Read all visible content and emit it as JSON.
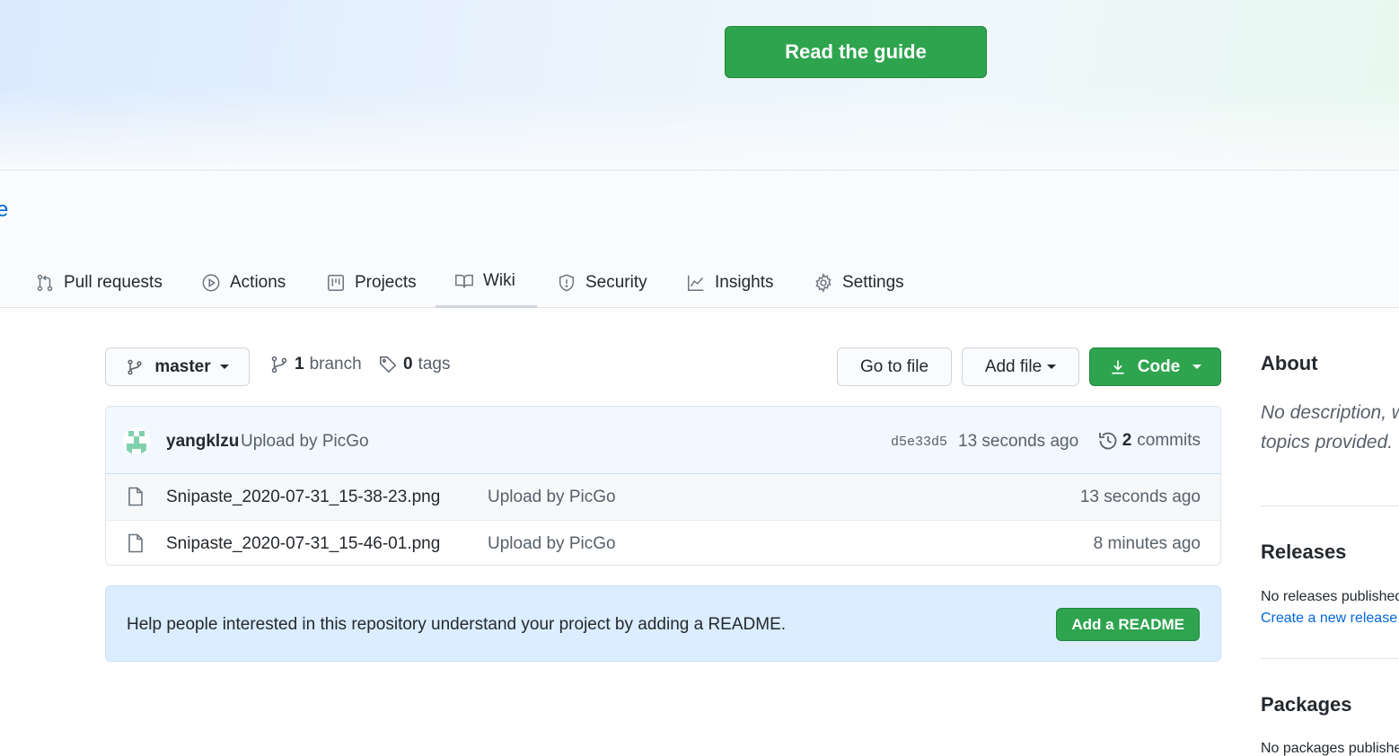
{
  "hero": {
    "guide_button": "Read the guide"
  },
  "repo": {
    "name_fragment": "e"
  },
  "tabs": [
    {
      "label": "Pull requests",
      "icon": "git-pull-request-icon"
    },
    {
      "label": "Actions",
      "icon": "play-icon"
    },
    {
      "label": "Projects",
      "icon": "project-icon"
    },
    {
      "label": "Wiki",
      "icon": "book-icon",
      "active": true
    },
    {
      "label": "Security",
      "icon": "shield-icon"
    },
    {
      "label": "Insights",
      "icon": "graph-icon"
    },
    {
      "label": "Settings",
      "icon": "gear-icon"
    }
  ],
  "toolbar": {
    "branch_select": "master",
    "branch_count": "1",
    "branch_label": "branch",
    "tag_count": "0",
    "tag_label": "tags",
    "go_to_file": "Go to file",
    "add_file": "Add file",
    "code": "Code"
  },
  "latest_commit": {
    "author": "yangklzu",
    "message": "Upload by PicGo",
    "sha": "d5e33d5",
    "time": "13 seconds ago",
    "commit_count": "2",
    "commit_label": "commits"
  },
  "files": [
    {
      "name": "Snipaste_2020-07-31_15-38-23.png",
      "message": "Upload by PicGo",
      "time": "13 seconds ago"
    },
    {
      "name": "Snipaste_2020-07-31_15-46-01.png",
      "message": "Upload by PicGo",
      "time": "8 minutes ago"
    }
  ],
  "readme_prompt": {
    "text": "Help people interested in this repository understand your project by adding a README.",
    "button": "Add a README"
  },
  "sidebar": {
    "about_title": "About",
    "about_desc": "No description, website, or topics provided.",
    "releases_title": "Releases",
    "releases_text": "No releases published",
    "releases_link": "Create a new release",
    "packages_title": "Packages",
    "packages_text": "No packages published"
  },
  "colors": {
    "green": "#2ea44f",
    "link": "#0366d6",
    "muted": "#586069"
  }
}
